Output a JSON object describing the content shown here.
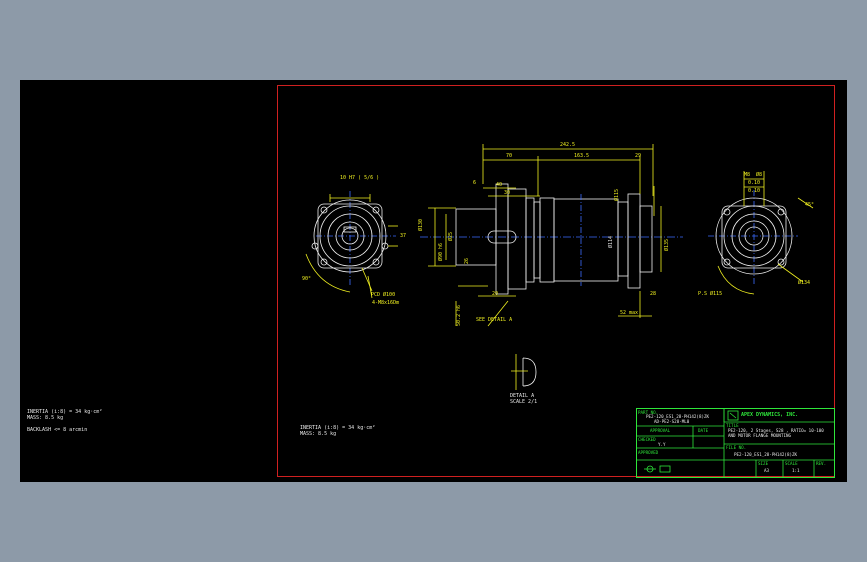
{
  "left_notes": {
    "inertia": "INERTIA (i:8) = 34 kg·cm²",
    "mass": "MASS: 8.5 kg",
    "backlash": "BACKLASH <= 8 arcmin"
  },
  "sheet_notes": {
    "inertia": "INERTIA (i:8) = 34 kg·cm²",
    "mass": "MASS: 8.5 kg"
  },
  "dims": {
    "total_length": "242.5",
    "d1": "70",
    "d2": "163.5",
    "d3": "29",
    "d4": "40",
    "d5": "30",
    "d6": "20",
    "d7": "28",
    "d8": "52 max",
    "d9": "6",
    "front_top": "10 H7 ( 5/6 )",
    "pcd": "PCD Ø100",
    "holes": "4-M8x16Dm",
    "dia_left1": "Ø130",
    "dia_left2": "Ø90 h6",
    "dia_left3": "Ø25",
    "dia_body": "Ø114",
    "dia_right": "Ø115",
    "dia_right2": "Ø135",
    "right_a": "Ø8",
    "right_b": "Ø134",
    "right_c": "P.S Ø115",
    "right_ang": "45°",
    "left_ang": "90°",
    "see_detail": "SEE DETAIL A",
    "detail_title": "DETAIL A",
    "detail_scale": "SCALE 2/1",
    "gd1": "M8",
    "gd2": "0.10",
    "gd3": "0.10",
    "side_a": "37",
    "side_b": "26",
    "side_c": "50.2 h6"
  },
  "title_block": {
    "part_no_label": "PART NO.",
    "part_no_1": "PE2-120_ES1_28-PH142(8)ZK",
    "part_no_2": "AD-PE2-S28-ML0",
    "company": "APEX DYNAMICS, INC.",
    "approval_label": "APPROVAL",
    "date_label": "DATE",
    "title_label": "TITLE",
    "title_1": "PE2-120, 2 Stages, S28 , RATIO= 10-100",
    "title_2": "AND MOTOR FLANGE MOUNTING",
    "checked_label": "CHECKED",
    "checked_val": "Y.Y",
    "file_label": "FILE NO.",
    "file_val": "PE2-120_ES1_28-PH142(8)ZK",
    "approved_label": "APPROVED",
    "size_label": "SIZE",
    "size_val": "A3",
    "scale_label": "SCALE",
    "scale_val": "1:1",
    "rev_label": "REV."
  },
  "colors": {
    "line": "#f0f0f0",
    "dimension": "#f0f020",
    "center": "#3b6cff",
    "frame": "#d02020",
    "title_block": "#2ee63a"
  }
}
